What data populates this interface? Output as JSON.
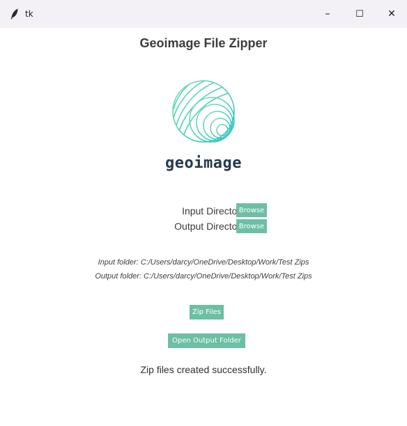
{
  "window": {
    "title": "tk",
    "controls": {
      "minimize": "–",
      "maximize": "☐",
      "close": "✕"
    }
  },
  "app": {
    "title": "Geoimage File Zipper",
    "logo_text": "geoimage"
  },
  "form": {
    "input_label": "Input Directory:",
    "output_label": "Output Directory:",
    "browse_label": "Browse"
  },
  "paths": {
    "input": "Input folder: C:/Users/darcy/OneDrive/Desktop/Work/Test Zips",
    "output": "Output folder: C:/Users/darcy/OneDrive/Desktop/Work/Test Zips"
  },
  "actions": {
    "zip_label": "Zip Files",
    "open_label": "Open Output Folder"
  },
  "status": {
    "message": "Zip files created successfully."
  },
  "colors": {
    "button_bg": "#6cbfa2",
    "logo_text": "#24384f",
    "titlebar_bg": "#f3f0f6"
  },
  "icons": {
    "app_icon": "tk-feather-icon",
    "logo": "geoimage-globe-logo"
  }
}
